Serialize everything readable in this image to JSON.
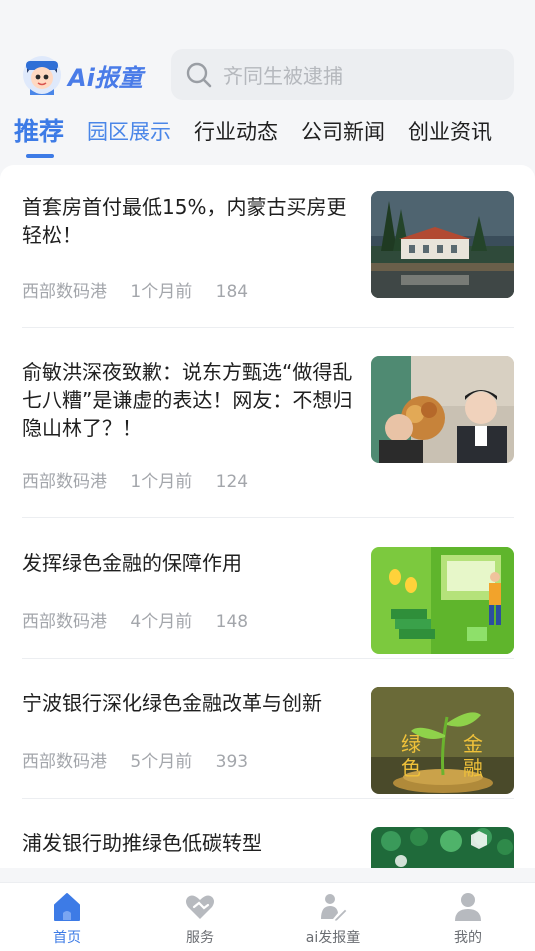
{
  "header": {
    "logo_text": "Ai报童",
    "search_placeholder": "齐同生被逮捕"
  },
  "tabs": [
    {
      "label": "推荐",
      "active": true
    },
    {
      "label": "园区展示",
      "active": false
    },
    {
      "label": "行业动态",
      "active": false
    },
    {
      "label": "公司新闻",
      "active": false
    },
    {
      "label": "创业资讯",
      "active": false
    }
  ],
  "articles": [
    {
      "title": "首套房首付最低15%，内蒙古买房更轻松！",
      "source": "西部数码港",
      "time": "1个月前",
      "views": "184",
      "thumb": "villa-lake-photo"
    },
    {
      "title": "俞敏洪深夜致歉：说东方甄选“做得乱七八糟”是谦虚的表达！网友：不想归隐山林了？！",
      "source": "西部数码港",
      "time": "1个月前",
      "views": "124",
      "thumb": "livestream-photo"
    },
    {
      "title": "发挥绿色金融的保障作用",
      "source": "西部数码港",
      "time": "4个月前",
      "views": "148",
      "thumb": "green-finance-illustration"
    },
    {
      "title": "宁波银行深化绿色金融改革与创新",
      "source": "西部数码港",
      "time": "5个月前",
      "views": "393",
      "thumb": "green-finance-sprout",
      "thumb_text": [
        "绿",
        "色",
        "金",
        "融"
      ]
    },
    {
      "title": "浦发银行助推绿色低碳转型",
      "source": "",
      "time": "",
      "views": "",
      "thumb": "eco-icons-photo"
    }
  ],
  "bottom_nav": [
    {
      "label": "首页",
      "icon": "home-icon",
      "active": true
    },
    {
      "label": "服务",
      "icon": "heart-handshake-icon",
      "active": false
    },
    {
      "label": "ai发报童",
      "icon": "writer-icon",
      "active": false
    },
    {
      "label": "我的",
      "icon": "user-icon",
      "active": false
    }
  ],
  "colors": {
    "accent": "#3d7be6",
    "meta_text": "#a3a6ab",
    "background": "#f5f6f8"
  }
}
